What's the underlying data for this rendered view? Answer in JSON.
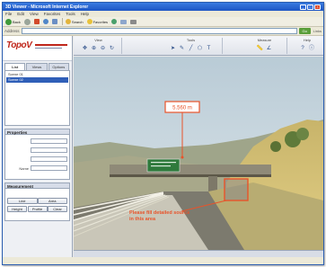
{
  "browser": {
    "title": "3D Viewer - Microsoft Internet Explorer",
    "menu": [
      "File",
      "Edit",
      "View",
      "Favorites",
      "Tools",
      "Help"
    ],
    "toolbar": {
      "back_label": "Back",
      "search_label": "Search",
      "favorites_label": "Favorites"
    },
    "address": {
      "label": "Address",
      "go_label": "Go",
      "links_label": "Links"
    }
  },
  "app": {
    "brand": {
      "name": "TopoV"
    },
    "tabs": [
      "List",
      "Views",
      "Options"
    ],
    "layers": [
      "Scene 01",
      "Scene 02"
    ],
    "selected_layer_index": 1,
    "properties": {
      "title": "Properties",
      "rows": [
        {
          "label": "Name"
        }
      ]
    },
    "measure": {
      "title": "Measurement",
      "buttons_row1": [
        "Line",
        "Area"
      ],
      "buttons_row2": [
        "Height",
        "Profile",
        "Clear"
      ]
    },
    "tool_groups": [
      "View",
      "Tools",
      "Measure",
      "Help"
    ]
  },
  "scene": {
    "callout_top": "5.560 m",
    "callout_bottom_line1": "Please fill detailed source",
    "callout_bottom_line2": "in this area",
    "accent_color": "#e8532a",
    "sign_color": "#2f7a3c"
  }
}
